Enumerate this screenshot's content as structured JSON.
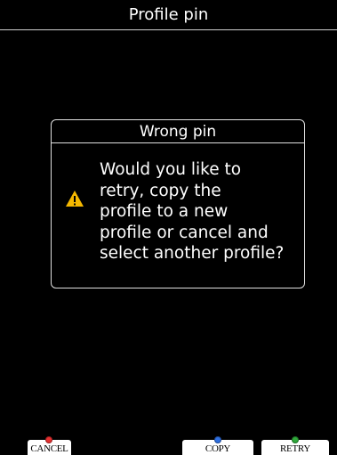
{
  "screen": {
    "title": "Profile pin"
  },
  "dialog": {
    "title": "Wrong pin",
    "message": "Would you like to\nretry, copy the\nprofile to a new\nprofile or cancel and\nselect another profile?",
    "icon": "warning-icon",
    "icon_color": "#f5b800"
  },
  "softkeys": {
    "cancel": {
      "label": "CANCEL",
      "indicator_color": "#e53030"
    },
    "copy": {
      "label": "COPY",
      "indicator_color": "#2f6fe0"
    },
    "retry": {
      "label": "RETRY",
      "indicator_color": "#2fa83a"
    }
  }
}
